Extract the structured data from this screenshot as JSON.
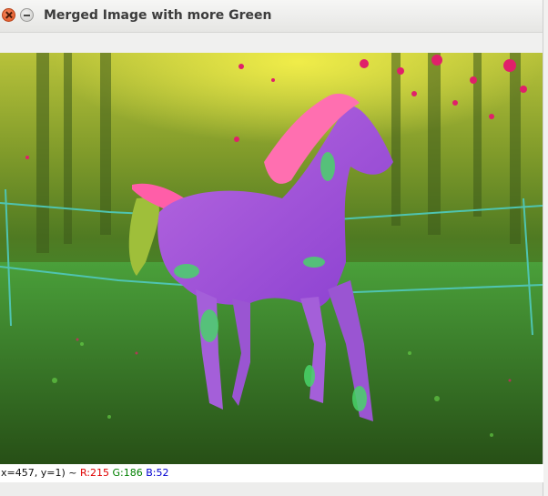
{
  "window": {
    "title": "Merged Image with more Green"
  },
  "statusbar": {
    "coords": "x=457, y=1) ~",
    "r_label": "R:215",
    "g_label": "G:186",
    "b_label": "B:52"
  },
  "colors": {
    "r_text": "#e00000",
    "g_text": "#008000",
    "b_text": "#0000d0"
  }
}
